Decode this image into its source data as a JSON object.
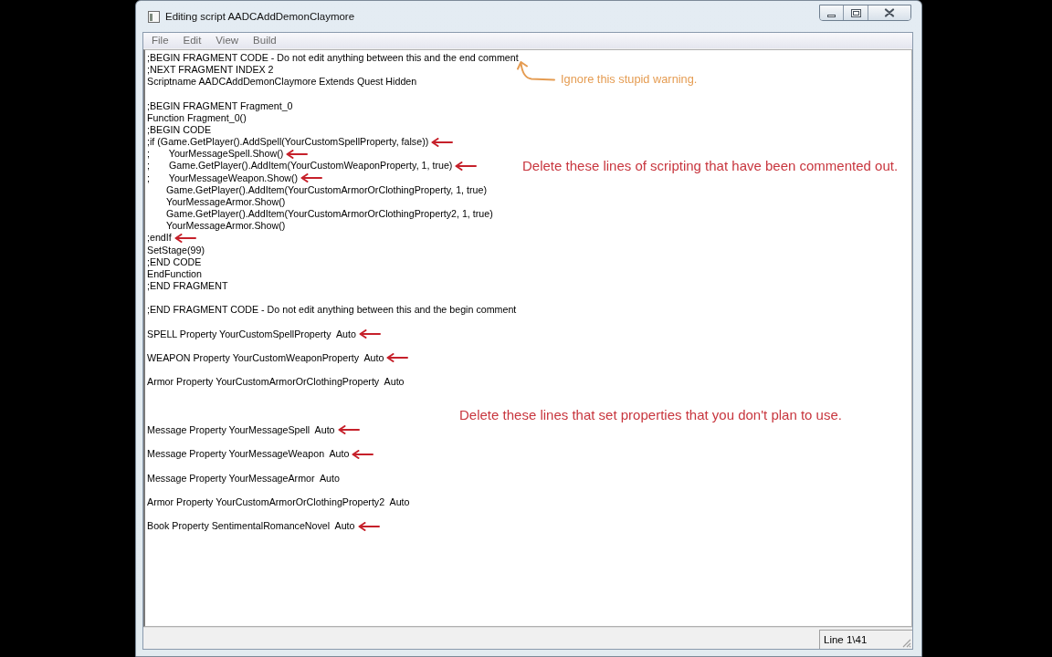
{
  "window": {
    "title": "Editing script AADCAddDemonClaymore"
  },
  "menu": [
    "File",
    "Edit",
    "View",
    "Build"
  ],
  "editor": {
    "lines": [
      {
        "kind": "code",
        "text": ";BEGIN FRAGMENT CODE - Do not edit anything between this and the end comment",
        "arrow": false
      },
      {
        "kind": "code",
        "text": ";NEXT FRAGMENT INDEX 2",
        "arrow": false
      },
      {
        "kind": "code",
        "text": "Scriptname AADCAddDemonClaymore Extends Quest Hidden",
        "arrow": false
      },
      {
        "kind": "blank",
        "arrow": false
      },
      {
        "kind": "code",
        "text": ";BEGIN FRAGMENT Fragment_0",
        "arrow": false
      },
      {
        "kind": "code",
        "text": "Function Fragment_0()",
        "arrow": false
      },
      {
        "kind": "code",
        "text": ";BEGIN CODE",
        "arrow": false
      },
      {
        "kind": "code",
        "text": ";if (Game.GetPlayer().AddSpell(YourCustomSpellProperty, false))",
        "arrow": true
      },
      {
        "kind": "code",
        "text": ";\t YourMessageSpell.Show()",
        "arrow": true
      },
      {
        "kind": "code",
        "text": ";\t Game.GetPlayer().AddItem(YourCustomWeaponProperty, 1, true)",
        "arrow": true
      },
      {
        "kind": "code",
        "text": ";\t YourMessageWeapon.Show()",
        "arrow": true
      },
      {
        "kind": "code",
        "text": "\tGame.GetPlayer().AddItem(YourCustomArmorOrClothingProperty, 1, true)",
        "arrow": false
      },
      {
        "kind": "code",
        "text": "\tYourMessageArmor.Show()",
        "arrow": false
      },
      {
        "kind": "code",
        "text": "\tGame.GetPlayer().AddItem(YourCustomArmorOrClothingProperty2, 1, true)",
        "arrow": false
      },
      {
        "kind": "code",
        "text": "\tYourMessageArmor.Show()",
        "arrow": false
      },
      {
        "kind": "code",
        "text": ";endIf",
        "arrow": true
      },
      {
        "kind": "code",
        "text": "SetStage(99)",
        "arrow": false
      },
      {
        "kind": "code",
        "text": ";END CODE",
        "arrow": false
      },
      {
        "kind": "code",
        "text": "EndFunction",
        "arrow": false
      },
      {
        "kind": "code",
        "text": ";END FRAGMENT",
        "arrow": false
      },
      {
        "kind": "blank",
        "arrow": false
      },
      {
        "kind": "code",
        "text": ";END FRAGMENT CODE - Do not edit anything between this and the begin comment",
        "arrow": false
      },
      {
        "kind": "blank",
        "arrow": false
      },
      {
        "kind": "code",
        "text": "SPELL Property YourCustomSpellProperty  Auto",
        "arrow": true
      },
      {
        "kind": "blank",
        "arrow": false
      },
      {
        "kind": "code",
        "text": "WEAPON Property YourCustomWeaponProperty  Auto",
        "arrow": true
      },
      {
        "kind": "blank",
        "arrow": false
      },
      {
        "kind": "code",
        "text": "Armor Property YourCustomArmorOrClothingProperty  Auto",
        "arrow": false
      },
      {
        "kind": "blank",
        "arrow": false
      },
      {
        "kind": "blank",
        "arrow": false
      },
      {
        "kind": "blank",
        "arrow": false
      },
      {
        "kind": "code",
        "text": "Message Property YourMessageSpell  Auto",
        "arrow": true
      },
      {
        "kind": "blank",
        "arrow": false
      },
      {
        "kind": "code",
        "text": "Message Property YourMessageWeapon  Auto",
        "arrow": true
      },
      {
        "kind": "blank",
        "arrow": false
      },
      {
        "kind": "code",
        "text": "Message Property YourMessageArmor  Auto",
        "arrow": false
      },
      {
        "kind": "blank",
        "arrow": false
      },
      {
        "kind": "code",
        "text": "Armor Property YourCustomArmorOrClothingProperty2  Auto",
        "arrow": false
      },
      {
        "kind": "blank",
        "arrow": false
      },
      {
        "kind": "code",
        "text": "Book Property SentimentalRomanceNovel  Auto",
        "arrow": true
      }
    ]
  },
  "notes": [
    {
      "text": "Ignore this stupid warning.",
      "color": "#e59c52",
      "pointer": true
    },
    {
      "text": "Delete these lines of scripting that have been commented out.",
      "color": "#c8363e",
      "pointer": false
    },
    {
      "text": "Delete these lines that set properties that you don't plan to use.",
      "color": "#c8363e",
      "pointer": false
    }
  ],
  "status_bar": {
    "position": "Line 1\\41"
  }
}
